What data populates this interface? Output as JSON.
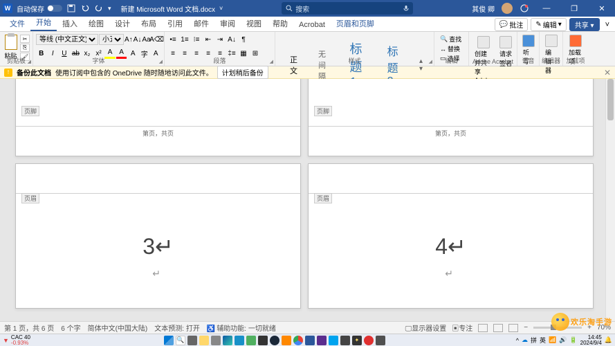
{
  "title_bar": {
    "autosave_label": "自动保存",
    "doc_title": "新建 Microsoft Word 文档.docx",
    "search_placeholder": "搜索",
    "user_name": "其俊 卿",
    "minimize": "—",
    "restore": "❐",
    "close": "✕"
  },
  "tabs": {
    "items": [
      "文件",
      "开始",
      "插入",
      "绘图",
      "设计",
      "布局",
      "引用",
      "邮件",
      "审阅",
      "视图",
      "帮助",
      "Acrobat",
      "页眉和页脚"
    ],
    "active_index": 1,
    "comments": "批注",
    "editing": "编辑",
    "share": "共享"
  },
  "ribbon": {
    "clipboard": {
      "paste": "粘贴",
      "label": "剪贴板"
    },
    "font": {
      "name": "等线 (中文正文)",
      "size": "小五",
      "label": "字体"
    },
    "paragraph": {
      "label": "段落"
    },
    "styles": {
      "normal": "正文",
      "nospace": "无间隔",
      "h1": "标题 1",
      "h2": "标题 2",
      "label": "样式"
    },
    "editing_group": {
      "find": "查找",
      "replace": "替换",
      "select": "选择",
      "label": "编辑"
    },
    "acrobat": {
      "create_share": "创建并共享",
      "adobe_pdf": "Adobe PDF",
      "request": "请求",
      "signatures": "签名",
      "label": "Adobe Acrobat"
    },
    "voice": {
      "dictate": "听写",
      "label": "语音"
    },
    "editor": {
      "editor": "编辑器",
      "label": "编辑器"
    },
    "addins": {
      "addins": "加载项",
      "label": "加载项"
    }
  },
  "warning": {
    "title": "备份此文档",
    "msg": "使用订阅中包含的 OneDrive 随时随地访问此文件。",
    "btn": "计划稍后备份"
  },
  "pages": {
    "footer_tag": "页脚",
    "header_tag": "页眉",
    "footer_text_1": "第页，共页",
    "footer_text_2": "第页，共页",
    "num_3": "3↵",
    "num_4": "4↵"
  },
  "status": {
    "page": "第 1 页，共 6 页",
    "words": "6 个字",
    "lang": "简体中文(中国大陆)",
    "predict": "文本预测: 打开",
    "access": "辅助功能: 一切就绪",
    "display_settings": "显示器设置",
    "focus": "专注",
    "zoom": "70%"
  },
  "taskbar": {
    "stock_name": "CAC 40",
    "stock_change": "-0.93%",
    "lang": "拼",
    "ime": "英",
    "time": "14:45",
    "date": "2024/9/4"
  },
  "watermark": {
    "text": "欢乐淘手游"
  }
}
